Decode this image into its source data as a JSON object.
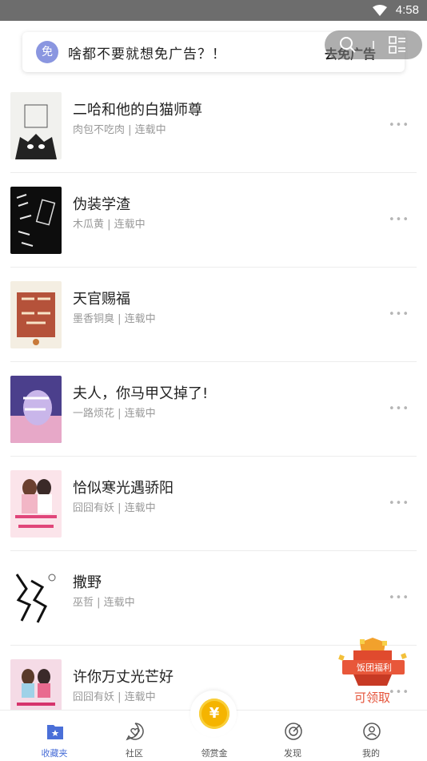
{
  "status_bar": {
    "time": "4:58"
  },
  "ad_banner": {
    "badge": "免",
    "text": "啥都不要就想免广告？！",
    "action": "去免广告"
  },
  "books": [
    {
      "title": "二哈和他的白猫师尊",
      "meta": "肉包不吃肉 | 连载中",
      "more": "•••"
    },
    {
      "title": "伪装学渣",
      "meta": "木瓜黄 | 连载中",
      "more": "•••"
    },
    {
      "title": "天官赐福",
      "meta": "墨香铜臭 | 连载中",
      "more": "•••"
    },
    {
      "title": "夫人，你马甲又掉了!",
      "meta": "一路烦花 | 连载中",
      "more": "•••"
    },
    {
      "title": "恰似寒光遇骄阳",
      "meta": "囧囧有妖 | 连载中",
      "more": "•••"
    },
    {
      "title": "撒野",
      "meta": "巫哲 | 连载中",
      "more": "•••"
    },
    {
      "title": "许你万丈光芒好",
      "meta": "囧囧有妖 | 连载中",
      "more": "•••"
    }
  ],
  "promo": {
    "sign": "饭团福利",
    "label": "可领取"
  },
  "tabs": [
    {
      "label": "收藏夹",
      "icon": "bookshelf-icon",
      "active": true
    },
    {
      "label": "社区",
      "icon": "community-icon",
      "active": false
    },
    {
      "label": "领赏金",
      "icon": "coin-icon",
      "active": false
    },
    {
      "label": "发现",
      "icon": "discover-icon",
      "active": false
    },
    {
      "label": "我的",
      "icon": "profile-icon",
      "active": false
    }
  ],
  "coin_symbol": "¥",
  "colors": {
    "accent": "#4a6fd8",
    "status_bar": "#6d6d6d",
    "coin": "#f5b400",
    "promo_text": "#e5533a"
  }
}
